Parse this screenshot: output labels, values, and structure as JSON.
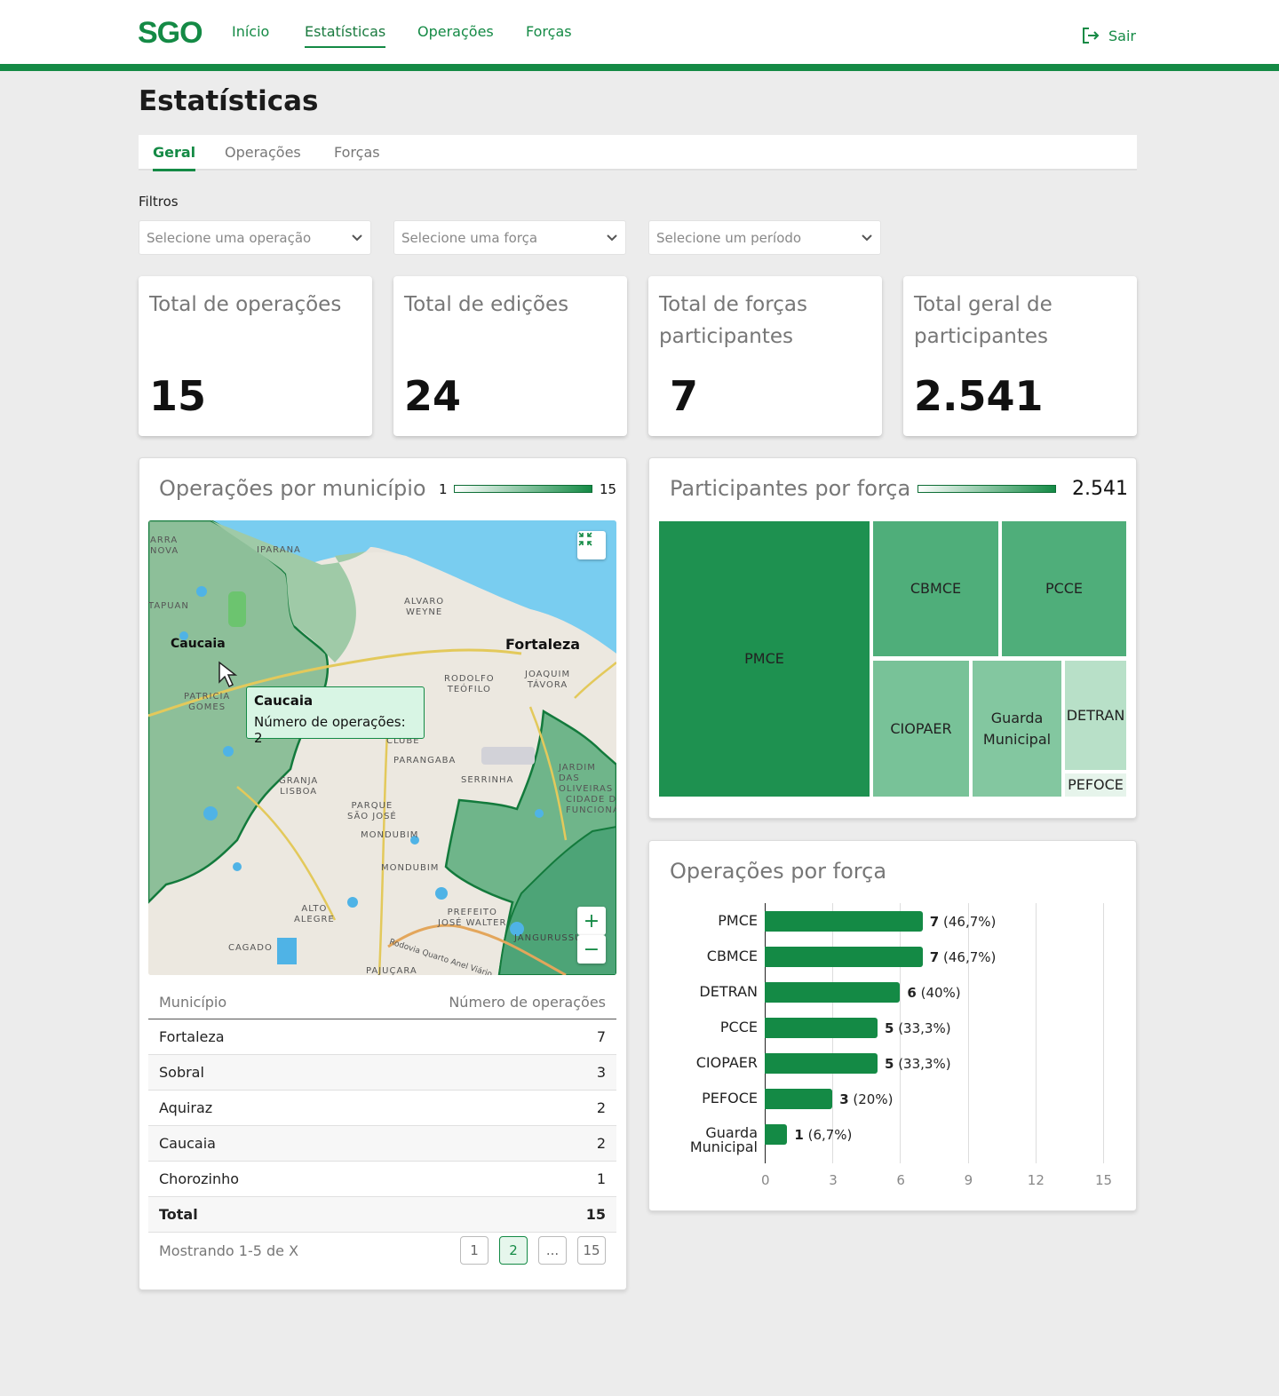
{
  "brand": "SGO",
  "nav": {
    "items": [
      "Início",
      "Estatísticas",
      "Operações",
      "Forças"
    ],
    "logout": "Sair"
  },
  "page": {
    "title": "Estatísticas"
  },
  "tabs": [
    "Geral",
    "Operações",
    "Forças"
  ],
  "filters": {
    "label": "Filtros",
    "operation_placeholder": "Selecione uma operação",
    "force_placeholder": "Selecione uma força",
    "period_placeholder": "Selecione um período"
  },
  "kpis": [
    {
      "title": "Total de operações",
      "value": "15"
    },
    {
      "title": "Total de edições",
      "value": "24"
    },
    {
      "title": "Total de forças participantes",
      "value": "7"
    },
    {
      "title": "Total geral de participantes",
      "value": "2.541"
    }
  ],
  "map_panel": {
    "title": "Operações por município",
    "legend_min": "1",
    "legend_max": "15",
    "labels": {
      "caucaia": "Caucaia",
      "fortaleza": "Fortaleza",
      "alvaro1": "ALVARO",
      "alvaro2": "WEYNE",
      "rodolfo1": "RODOLFO",
      "rodolfo2": "TEÓFILO",
      "joaquim1": "JOAQUIM",
      "joaquim2": "TÁVORA",
      "parangaba": "PARANGABA",
      "serrinha": "SERRINHA",
      "granja1": "GRANJA",
      "granja2": "LISBOA",
      "parque1": "PARQUE",
      "parque2": "SÃO JOSÉ",
      "mondubim": "MONDUBIM",
      "alto1": "ALTO",
      "alto2": "ALEGRE",
      "prefeito1": "PREFEITO",
      "prefeito2": "JOSÉ WALTER",
      "jangurussu": "JANGURUSSU",
      "patricia1": "PATRICIA",
      "patricia2": "GOMES",
      "tapuan": "TAPUAN",
      "iparana": "IPARANA",
      "jardim1": "JARDIM DAS",
      "jardim2": "OLIVEIRAS",
      "cidade1": "CIDADE DOS",
      "cidade2": "FUNCIONÁRIOS",
      "cagado": "CAGADO",
      "rodovia": "Rodovia Quarto Anel Viário",
      "clube": "CLUBE",
      "pajucara": "PAJUÇARA",
      "barra1": "ARRA",
      "barra2": "NOVA"
    },
    "zoom_in": "+",
    "zoom_out": "−",
    "tooltip": {
      "title": "Caucaia",
      "text": "Número de operações: 2"
    }
  },
  "municipio_table": {
    "headers": [
      "Município",
      "Número de operações"
    ],
    "rows": [
      [
        "Fortaleza",
        "7"
      ],
      [
        "Sobral",
        "3"
      ],
      [
        "Aquiraz",
        "2"
      ],
      [
        "Caucaia",
        "2"
      ],
      [
        "Chorozinho",
        "1"
      ]
    ],
    "total": [
      "Total",
      "15"
    ],
    "footer": "Mostrando 1-5 de X",
    "pages": [
      "1",
      "2",
      "...",
      "15"
    ],
    "active_page": "2"
  },
  "treemap_panel": {
    "title": "Participantes por força",
    "legend_value": "2.541",
    "labels": {
      "pmce": "PMCE",
      "cbmce": "CBMCE",
      "pcce": "PCCE",
      "ciopaer": "CIOPAER",
      "guarda1": "Guarda",
      "guarda2": "Municipal",
      "detran": "DETRAN",
      "pefoce": "PEFOCE"
    },
    "colors": {
      "pmce": "#1e9150",
      "cbmce": "#4fae7a",
      "pcce": "#4fae7a",
      "ciopaer": "#78c298",
      "guarda": "#83c7a0",
      "detran": "#b8e0c8",
      "pefoce": "#e6f4eb"
    }
  },
  "chart_data": {
    "type": "bar",
    "orientation": "horizontal",
    "title": "Operações por força",
    "categories": [
      "PMCE",
      "CBMCE",
      "DETRAN",
      "PCCE",
      "CIOPAER",
      "PEFOCE",
      "Guarda Municipal"
    ],
    "values": [
      7,
      7,
      6,
      5,
      5,
      3,
      1
    ],
    "value_labels": [
      "(46,7%)",
      "(46,7%)",
      "(40%)",
      "(33,3%)",
      "(33,3%)",
      "(20%)",
      "(6,7%)"
    ],
    "xticks": [
      "0",
      "3",
      "6",
      "9",
      "12",
      "15"
    ],
    "xlim": [
      0,
      15
    ],
    "grid": true,
    "bar_color": "#148a45"
  }
}
